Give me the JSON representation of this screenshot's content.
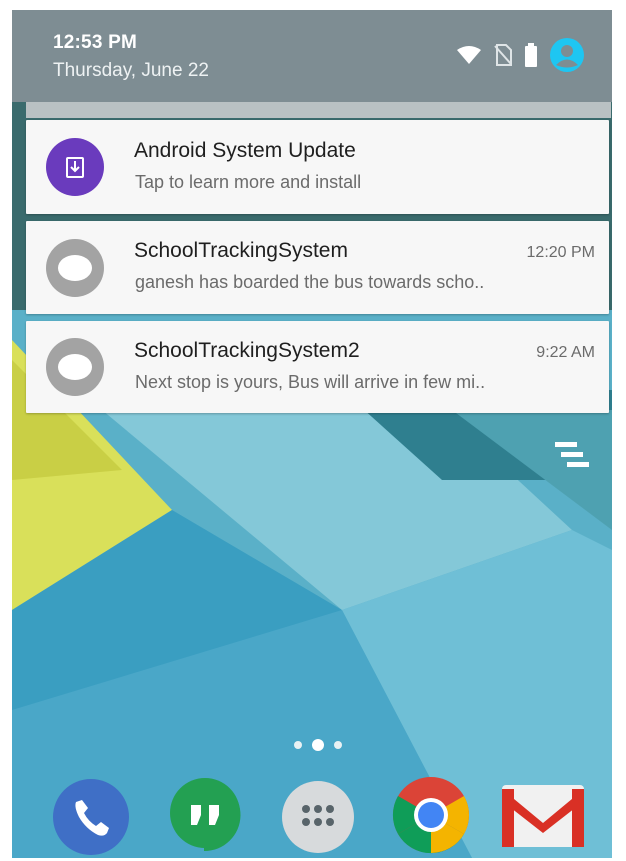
{
  "status_bar": {
    "time": "12:53 PM",
    "date": "Thursday, June 22",
    "icons": [
      "wifi-icon",
      "no-sim-icon",
      "battery-icon",
      "account-icon"
    ]
  },
  "notifications": [
    {
      "icon": "system-update-icon",
      "title": "Android System Update",
      "text": "Tap to learn more and install",
      "time": ""
    },
    {
      "icon": "app-icon",
      "title": "SchoolTrackingSystem",
      "text": "ganesh has boarded the bus towards scho..",
      "time": "12:20 PM"
    },
    {
      "icon": "app-icon",
      "title": "SchoolTrackingSystem2",
      "text": "Next stop is yours, Bus will arrive in few mi..",
      "time": "9:22 AM"
    }
  ],
  "clear_all": "clear-all-icon",
  "dock": [
    "phone-icon",
    "hangouts-icon",
    "app-drawer-icon",
    "chrome-icon",
    "gmail-icon"
  ],
  "colors": {
    "header": "#7e8d93",
    "card": "#f7f7f7",
    "update_icon": "#6a3bbd",
    "accent_account": "#1ec6f2"
  }
}
